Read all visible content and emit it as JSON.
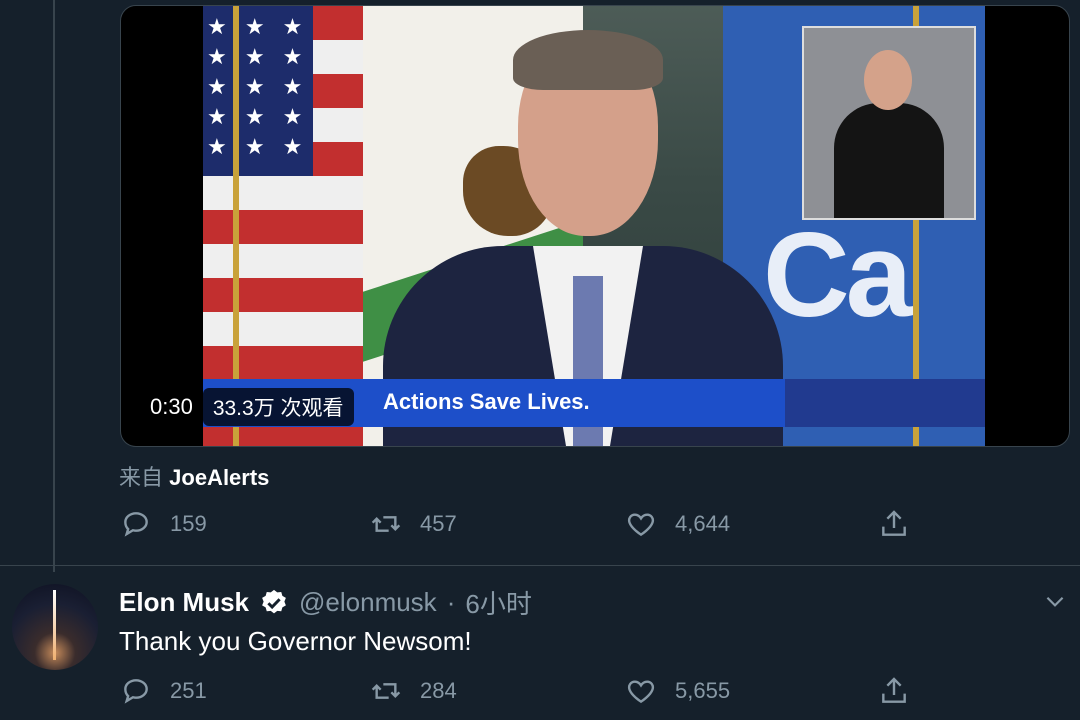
{
  "video": {
    "duration": "0:30",
    "views": "33.3万 次观看",
    "caption": "Actions Save Lives.",
    "flag_text": "Ca"
  },
  "source": {
    "prefix": "来自",
    "name": "JoeAlerts"
  },
  "first_tweet_actions": {
    "replies": "159",
    "retweets": "457",
    "likes": "4,644"
  },
  "reply_tweet": {
    "name": "Elon Musk",
    "handle": "@elonmusk",
    "separator": "·",
    "time": "6小时",
    "text": "Thank you Governor Newsom!",
    "actions": {
      "replies": "251",
      "retweets": "284",
      "likes": "5,655"
    }
  },
  "colors": {
    "background": "#15202b",
    "secondary_text": "#8899a6",
    "verified": "#ffffff",
    "border": "#38444d"
  }
}
